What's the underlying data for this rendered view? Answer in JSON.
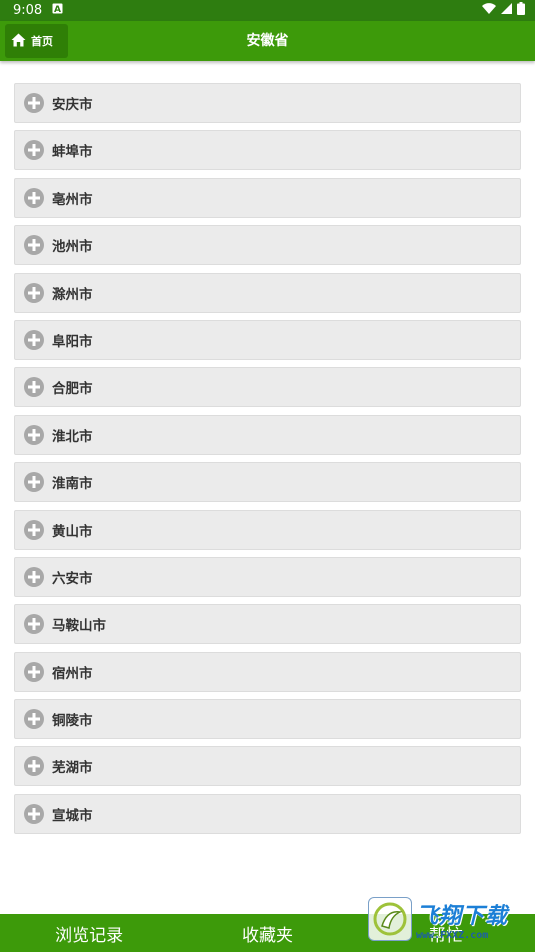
{
  "status_bar": {
    "time": "9:08",
    "icons": [
      "notification-a-icon",
      "wifi-icon",
      "signal-icon",
      "battery-icon"
    ]
  },
  "app_bar": {
    "home_label": "首页",
    "title": "安徽省"
  },
  "cities": [
    {
      "label": "安庆市"
    },
    {
      "label": "蚌埠市"
    },
    {
      "label": "亳州市"
    },
    {
      "label": "池州市"
    },
    {
      "label": "滁州市"
    },
    {
      "label": "阜阳市"
    },
    {
      "label": "合肥市"
    },
    {
      "label": "淮北市"
    },
    {
      "label": "淮南市"
    },
    {
      "label": "黄山市"
    },
    {
      "label": "六安市"
    },
    {
      "label": "马鞍山市"
    },
    {
      "label": "宿州市"
    },
    {
      "label": "铜陵市"
    },
    {
      "label": "芜湖市"
    },
    {
      "label": "宣城市"
    }
  ],
  "bottom_tabs": [
    {
      "label": "浏览记录"
    },
    {
      "label": "收藏夹"
    },
    {
      "label": "帮忙"
    }
  ],
  "watermark": {
    "title": "飞翔下载",
    "url": "www.FXXZ.com"
  },
  "colors": {
    "status_bar": "#2e7d10",
    "app_bar": "#3d9a0a",
    "home_button": "#2f7f06",
    "list_item_bg": "#ebebeb",
    "plus_icon": "#a8a8a8"
  }
}
